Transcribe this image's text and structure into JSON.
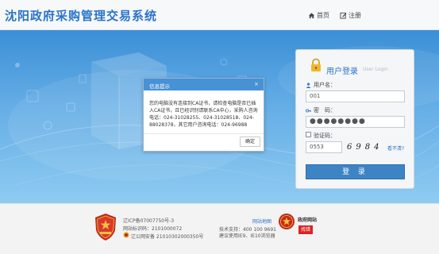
{
  "header": {
    "site_title": "沈阳政府采购管理交易系统",
    "nav": [
      {
        "label": "首页",
        "icon": "home-icon"
      },
      {
        "label": "注册",
        "icon": "edit-icon"
      }
    ]
  },
  "login": {
    "title": "用户登录",
    "subtitle": "User Login",
    "username_label": "用户名：",
    "username_value": "001",
    "password_label": "密　码：",
    "password_value": "●●●●●●●●",
    "captcha_label": "验证码：",
    "captcha_value": "0553",
    "captcha_image_text": "6984",
    "captcha_refresh": "看不清?",
    "login_button": "登 录"
  },
  "dialog": {
    "title": "信息提示",
    "close": "×",
    "message": "您的电脑没有连接到CA证书，请检查电脑是否已插入CA证书，且已经识别请联系CA中心，采购人咨询电话：024-31028255、024-31028518、024-88028378，其它用户咨询电话：024-96988",
    "ok_button": "确定"
  },
  "footer": {
    "icp": "辽ICP备07007750号-3",
    "site_id": "网站标识码：2101000072",
    "police_record": "辽公网安备 21010302000350号",
    "sitemap_link": "网站地图",
    "support": "技术支持：400 100 9691",
    "browser": "建议使用IE9、IE10浏览器",
    "gov_site_label": "政府网站",
    "gov_site_sub": "找错"
  },
  "colors": {
    "brand_blue": "#2b73c9",
    "hero_top": "#3b8fd6",
    "login_button": "#3d84c5",
    "dialog_header": "#4791d5"
  }
}
